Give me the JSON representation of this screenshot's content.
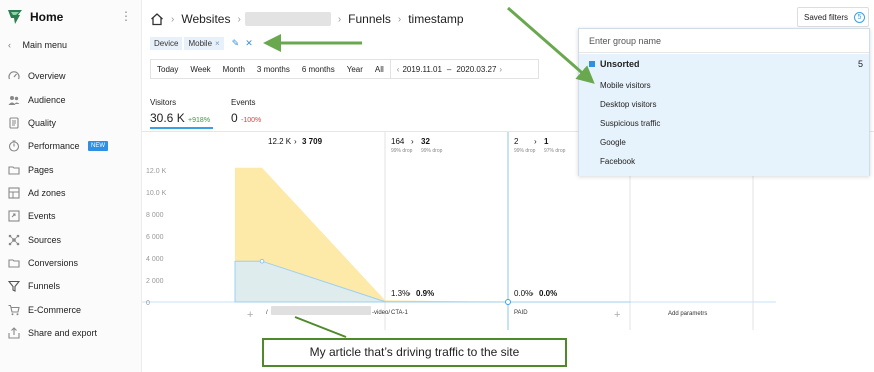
{
  "sidebar": {
    "home_label": "Home",
    "main_menu_label": "Main menu",
    "items": [
      {
        "label": "Overview",
        "icon": "overview-icon"
      },
      {
        "label": "Audience",
        "icon": "audience-icon"
      },
      {
        "label": "Quality",
        "icon": "quality-icon"
      },
      {
        "label": "Performance",
        "icon": "performance-icon",
        "badge": "NEW"
      },
      {
        "label": "Pages",
        "icon": "pages-icon"
      },
      {
        "label": "Ad zones",
        "icon": "ad-zones-icon"
      },
      {
        "label": "Events",
        "icon": "events-icon"
      },
      {
        "label": "Sources",
        "icon": "sources-icon"
      },
      {
        "label": "Conversions",
        "icon": "conversions-icon"
      },
      {
        "label": "Funnels",
        "icon": "funnels-icon"
      },
      {
        "label": "E-Commerce",
        "icon": "ecommerce-icon"
      },
      {
        "label": "Share and export",
        "icon": "share-icon"
      }
    ]
  },
  "breadcrumb": {
    "websites": "Websites",
    "funnels": "Funnels",
    "current": "timestamp"
  },
  "saved_filters": {
    "label": "Saved filters",
    "count": "5"
  },
  "segment_chips": [
    {
      "label": "Device"
    },
    {
      "label": "Mobile"
    }
  ],
  "period": {
    "options": [
      "Today",
      "Week",
      "Month",
      "3 months",
      "6 months",
      "Year",
      "All"
    ],
    "date_from": "2019.11.01",
    "date_sep": "–",
    "date_to": "2020.03.27"
  },
  "metrics": {
    "visitors": {
      "label": "Visitors",
      "value": "30.6 K",
      "change": "+918%"
    },
    "events": {
      "label": "Events",
      "value": "0",
      "change": "-100%"
    }
  },
  "chart_data": {
    "type": "area",
    "y_ticks": [
      "12.0 K",
      "10.0 K",
      "8 000",
      "6 000",
      "4 000",
      "2 000",
      "0"
    ],
    "ylim": [
      0,
      12000
    ],
    "steps": [
      {
        "label_suffix": "-video/",
        "from": "12.2 K",
        "to": "3 709",
        "from_sub": "",
        "to_sub": "",
        "conv": "",
        "conv_val": ""
      },
      {
        "label": "CTA-1",
        "from": "164",
        "to": "32",
        "from_sub": "99% drop",
        "to_sub": "99% drop",
        "conv": "1.3%",
        "conv_val": "0.9%"
      },
      {
        "label": "PAID",
        "from": "2",
        "to": "1",
        "from_sub": "99% drop",
        "to_sub": "97% drop",
        "conv": "0.0%",
        "conv_val": "0.0%"
      }
    ],
    "series": [
      {
        "values": [
          12200,
          164,
          2
        ]
      },
      {
        "values": [
          3709,
          32,
          1
        ]
      }
    ],
    "add_label": "Add parametrs"
  },
  "dropdown": {
    "search_placeholder": "Enter group name",
    "group_name": "Unsorted",
    "group_count": "5",
    "items": [
      "Mobile visitors",
      "Desktop visitors",
      "Suspicious traffic",
      "Google",
      "Facebook"
    ]
  },
  "annotation": {
    "text": "My article that’s driving traffic to the site"
  },
  "colors": {
    "accent": "#2f8fe6",
    "arrow": "#6aa84f",
    "area_total": "#fde9a8",
    "area_blue": "#d8ecfa"
  }
}
